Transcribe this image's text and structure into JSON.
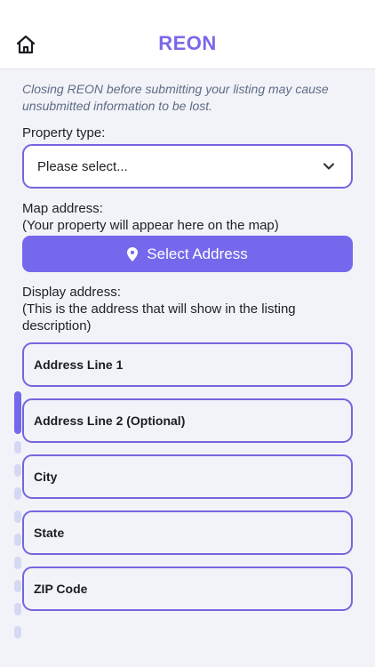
{
  "header": {
    "title": "REON",
    "home_icon": "home-icon"
  },
  "notice": "Closing REON before submitting your listing may cause unsubmitted information to be lost.",
  "property_type": {
    "label": "Property type:",
    "value": "Please select..."
  },
  "map_address": {
    "label_line1": "Map address:",
    "label_line2": "(Your property will appear here on the map)",
    "button_label": "Select Address",
    "button_icon": "location-pin-icon"
  },
  "display_address": {
    "label_line1": "Display address:",
    "label_line2": "(This is the address that will show in the listing description)",
    "fields": {
      "line1": "Address Line 1",
      "line2": "Address Line 2 (Optional)",
      "city": "City",
      "state": "State",
      "zip": "ZIP Code"
    }
  },
  "colors": {
    "accent": "#7568ec",
    "title": "#7a68ea",
    "border": "#7565e0",
    "background": "#f1f3f8"
  }
}
